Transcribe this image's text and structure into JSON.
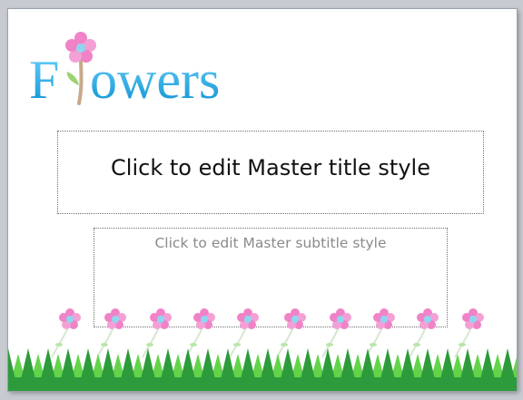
{
  "logo": {
    "first_letter": "F",
    "rest": "owers",
    "word": "Flowers"
  },
  "placeholders": {
    "title": "Click to edit Master title style",
    "subtitle": "Click to edit Master subtitle style"
  },
  "colors": {
    "logo_blue": "#1ea7e1",
    "petal_pink": "#f082c8",
    "flower_center": "#8fd6f0",
    "grass_light": "#63d34a",
    "grass_dark": "#2d9b3b",
    "stem": "#c8a98a"
  },
  "icons": {
    "logo_flower": "flower-icon",
    "border_flowers": "flower-row"
  }
}
